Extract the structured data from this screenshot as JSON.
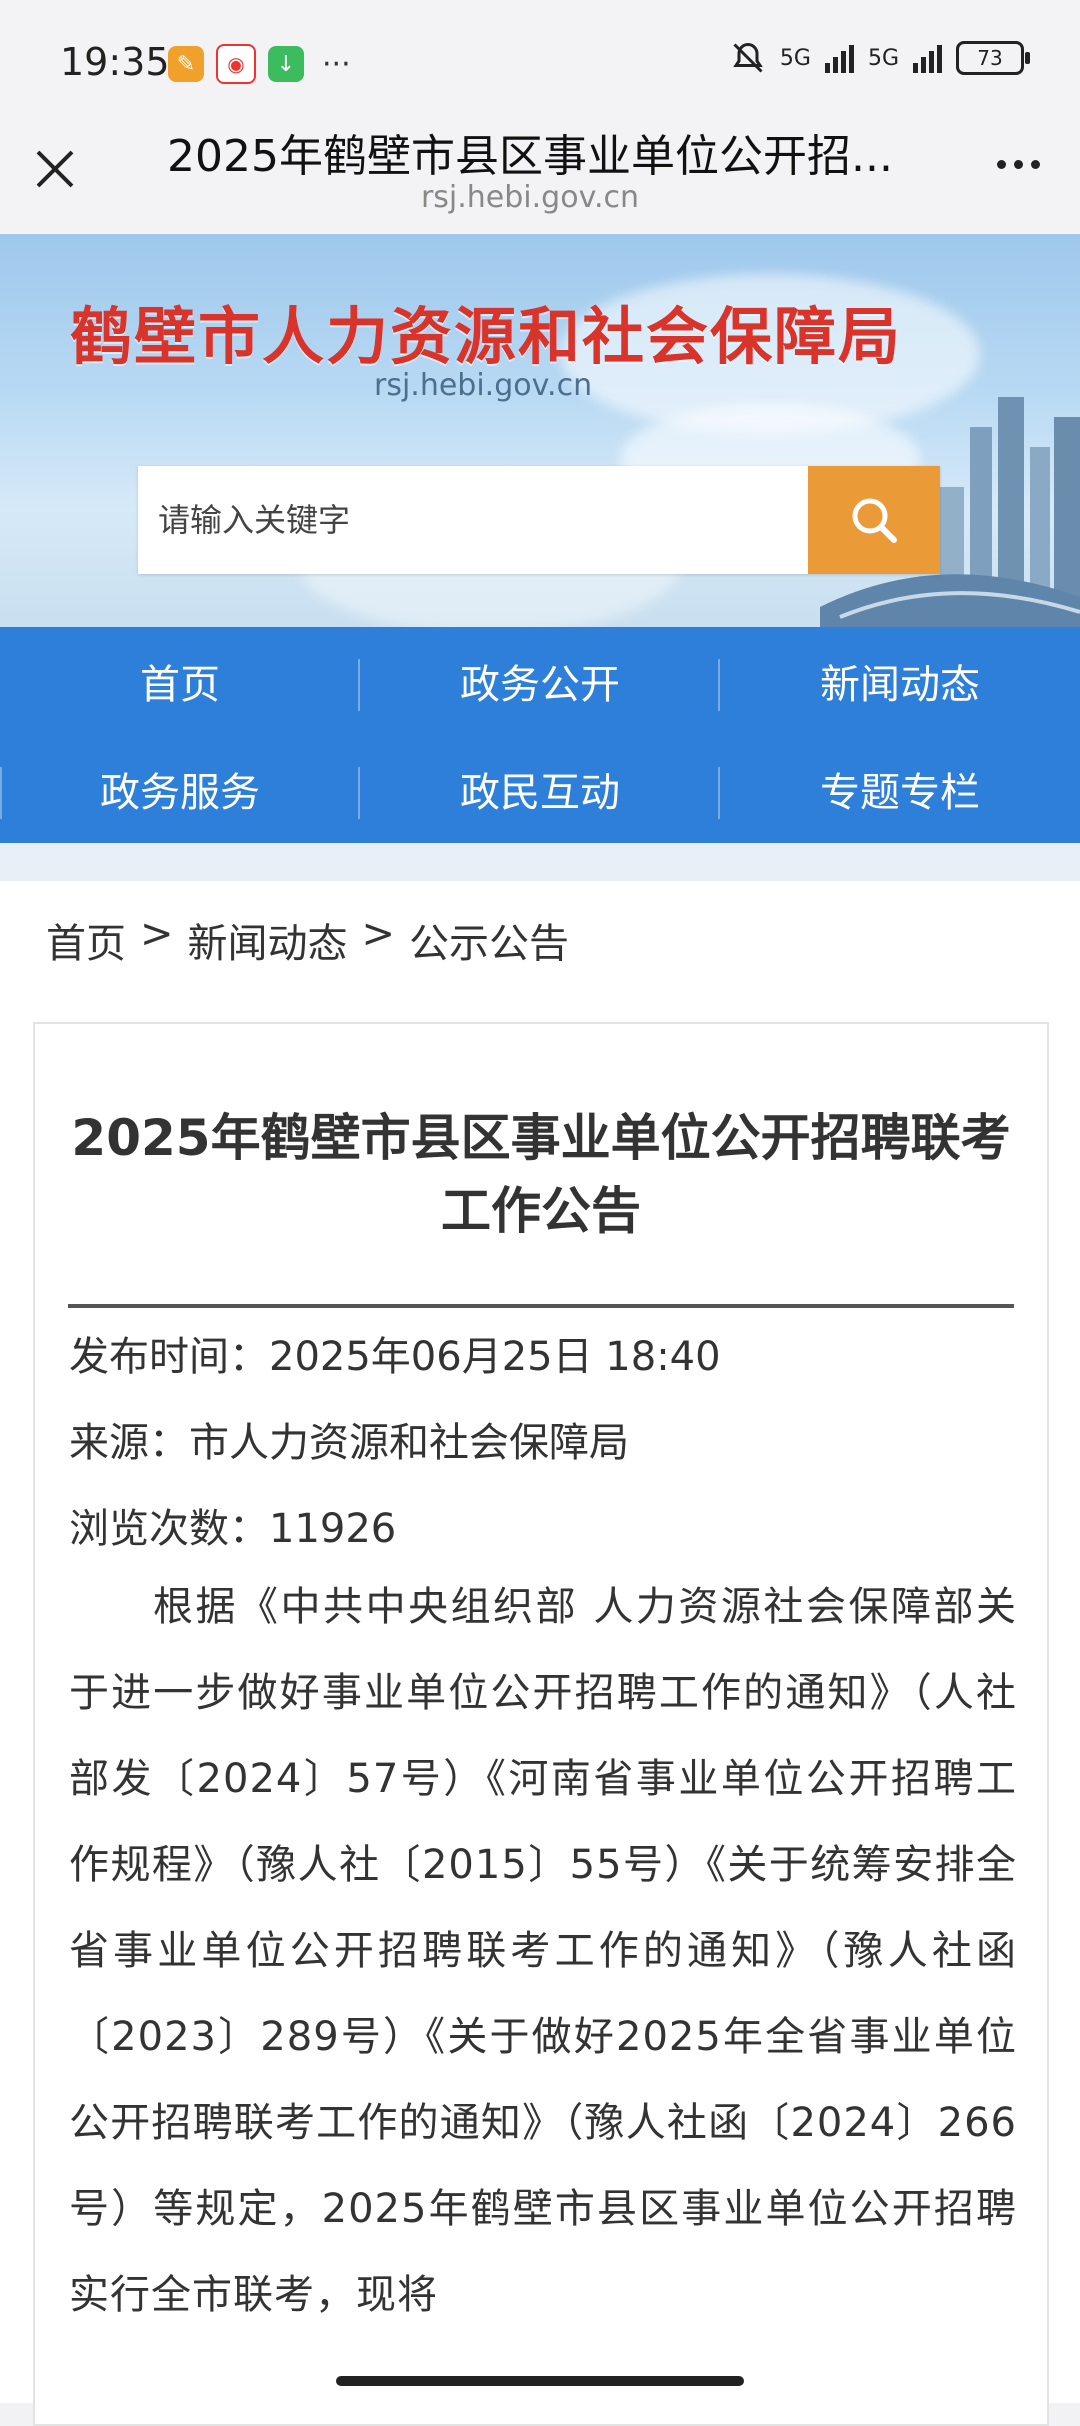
{
  "status_bar": {
    "time": "19:35",
    "battery": "73",
    "net1": "5G",
    "net2": "5G",
    "more": "···"
  },
  "browser": {
    "title": "2025年鹤壁市县区事业单位公开招...",
    "url": "rsj.hebi.gov.cn"
  },
  "site": {
    "brand": "鹤壁市人力资源和社会保障局",
    "brand_url": "rsj.hebi.gov.cn",
    "search_placeholder": "请输入关键字"
  },
  "menu": {
    "row1": [
      "首页",
      "政务公开",
      "新闻动态"
    ],
    "row2": [
      "政务服务",
      "政民互动",
      "专题专栏"
    ]
  },
  "breadcrumb": {
    "home": "首页",
    "sep1": ">",
    "news": "新闻动态",
    "sep2": ">",
    "current": "公示公告"
  },
  "article": {
    "title": "2025年鹤壁市县区事业单位公开招聘联考工作公告",
    "publish_time": "发布时间：2025年06月25日 18:40",
    "source": "来源：市人力资源和社会保障局",
    "views": "浏览次数：11926",
    "body": "根据《中共中央组织部 人力资源社会保障部关于进一步做好事业单位公开招聘工作的通知》（人社部发〔2024〕57号）《河南省事业单位公开招聘工作规程》（豫人社〔2015〕55号）《关于统筹安排全省事业单位公开招聘联考工作的通知》（豫人社函〔2023〕289号）《关于做好2025年全省事业单位公开招聘联考工作的通知》（豫人社函〔2024〕266号）等规定，2025年鹤壁市县区事业单位公开招聘实行全市联考，现将"
  },
  "colors": {
    "brand_red": "#d9342b",
    "menu_blue": "#2e7fd9",
    "search_orange": "#ea9a37"
  }
}
